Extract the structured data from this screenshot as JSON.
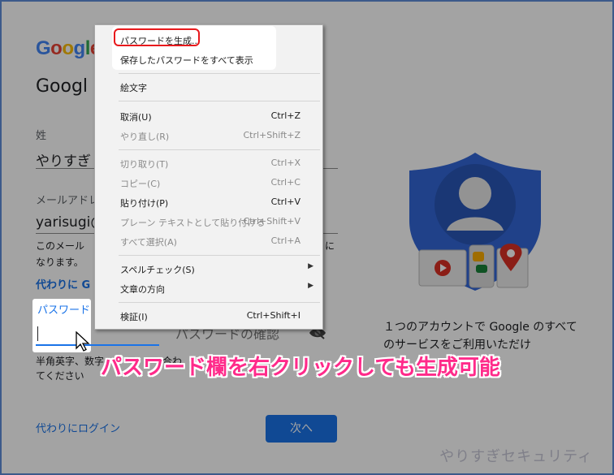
{
  "form": {
    "logo_letters": [
      {
        "ch": "G",
        "color": "b"
      },
      {
        "ch": "o",
        "color": "r"
      },
      {
        "ch": "o",
        "color": "y"
      },
      {
        "ch": "g",
        "color": "b"
      },
      {
        "ch": "l",
        "color": "g"
      },
      {
        "ch": "e",
        "color": "r"
      }
    ],
    "heading": "Googl",
    "last_name_label": "姓",
    "last_name_value": "やりすぎ",
    "email_label": "メールアドレ",
    "email_value": "yarisugi@",
    "email_note_line1": "このメール",
    "email_note_line1b": "に",
    "email_note_line2": "なります。",
    "alt_link": "代わりに G",
    "password_label": "パスワード",
    "confirm_placeholder": "パスワードの確認",
    "hint_line1": "半角英字、数字",
    "hint_line1b": "合わ",
    "hint_line2": "てください",
    "login_instead": "代わりにログイン",
    "next_button": "次へ",
    "caption": "１つのアカウントで Google のすべてのサービスをご利用いただけ",
    "caption_end": "。"
  },
  "context_menu": {
    "items": [
      {
        "label": "パスワードを生成...",
        "shortcut": "",
        "disabled": false,
        "submenu": false
      },
      {
        "label": "保存したパスワードをすべて表示",
        "shortcut": "",
        "disabled": false,
        "submenu": false
      },
      {
        "label": "絵文字",
        "shortcut": "",
        "disabled": false,
        "submenu": false
      },
      {
        "label": "取消(U)",
        "shortcut": "Ctrl+Z",
        "disabled": false,
        "submenu": false
      },
      {
        "label": "やり直し(R)",
        "shortcut": "Ctrl+Shift+Z",
        "disabled": true,
        "submenu": false
      },
      {
        "label": "切り取り(T)",
        "shortcut": "Ctrl+X",
        "disabled": true,
        "submenu": false
      },
      {
        "label": "コピー(C)",
        "shortcut": "Ctrl+C",
        "disabled": true,
        "submenu": false
      },
      {
        "label": "貼り付け(P)",
        "shortcut": "Ctrl+V",
        "disabled": false,
        "submenu": false
      },
      {
        "label": "プレーン テキストとして貼り付ける",
        "shortcut": "Ctrl+Shift+V",
        "disabled": true,
        "submenu": false
      },
      {
        "label": "すべて選択(A)",
        "shortcut": "Ctrl+A",
        "disabled": true,
        "submenu": false
      },
      {
        "label": "スペルチェック(S)",
        "shortcut": "",
        "disabled": false,
        "submenu": true
      },
      {
        "label": "文章の方向",
        "shortcut": "",
        "disabled": false,
        "submenu": true
      },
      {
        "label": "検証(I)",
        "shortcut": "Ctrl+Shift+I",
        "disabled": false,
        "submenu": false
      }
    ]
  },
  "annotation": "パスワード欄を右クリックしても生成可能",
  "watermark": "やりすぎセキュリティ",
  "colors": {
    "accent": "#1a73e8",
    "highlight_border": "#e8191c",
    "annotation": "#ff2a8a",
    "shield": "#3367d6"
  }
}
